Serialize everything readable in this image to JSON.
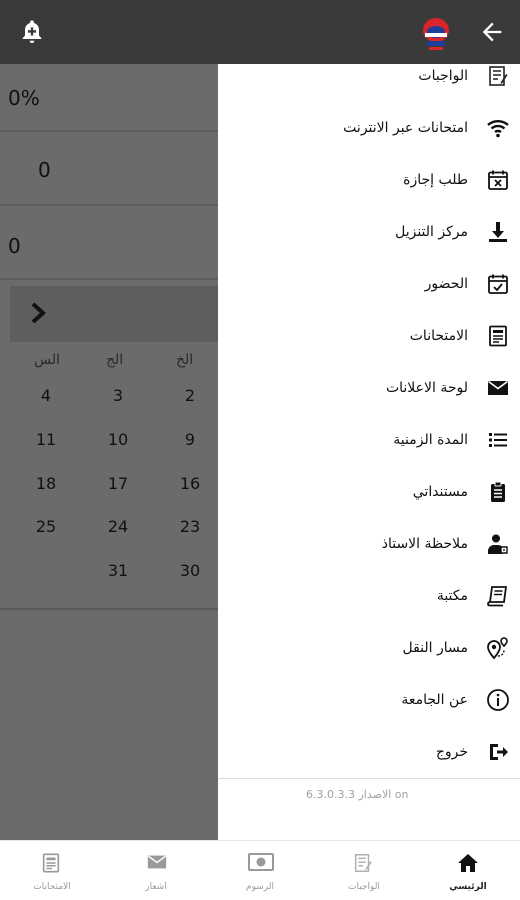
{
  "background": {
    "progress": "0%",
    "value_a": "0",
    "value_b": "0",
    "calendar": {
      "weekdays": [
        "الخ",
        "الج",
        "الس"
      ],
      "rows": [
        [
          "2",
          "3",
          "4"
        ],
        [
          "9",
          "10",
          "11"
        ],
        [
          "16",
          "17",
          "18"
        ],
        [
          "23",
          "24",
          "25"
        ],
        [
          "30",
          "31",
          ""
        ]
      ]
    }
  },
  "drawer": {
    "items": [
      {
        "label": "الواجبات",
        "icon": "homework-icon"
      },
      {
        "label": "امتحانات عبر الانترنت",
        "icon": "wifi-icon"
      },
      {
        "label": "طلب إجازة",
        "icon": "calendar-x-icon"
      },
      {
        "label": "مركز التنزيل",
        "icon": "download-icon"
      },
      {
        "label": "الحضور",
        "icon": "calendar-check-icon"
      },
      {
        "label": "الامتحانات",
        "icon": "exam-icon"
      },
      {
        "label": "لوحة الاعلانات",
        "icon": "envelope-icon"
      },
      {
        "label": "المدة الزمنية",
        "icon": "list-icon"
      },
      {
        "label": "مستنداتي",
        "icon": "clipboard-icon"
      },
      {
        "label": "ملاحظة الاستاذ",
        "icon": "teacher-icon"
      },
      {
        "label": "مكتبة",
        "icon": "book-icon"
      },
      {
        "label": "مسار النقل",
        "icon": "route-pin-icon"
      },
      {
        "label": "عن الجامعة",
        "icon": "info-icon"
      },
      {
        "label": "خروج",
        "icon": "logout-icon"
      }
    ],
    "version": "الاصدار 6.3.0.3.3 on"
  },
  "bottom_nav": {
    "items": [
      {
        "label": "الامتحانات",
        "icon": "exam-icon"
      },
      {
        "label": "اشعار",
        "icon": "envelope-icon"
      },
      {
        "label": "الرسوم",
        "icon": "money-icon"
      },
      {
        "label": "الواجبات",
        "icon": "homework-icon"
      },
      {
        "label": "الرئيسي",
        "icon": "home-icon"
      }
    ],
    "active_index": 4
  },
  "colors": {
    "topbar": "#3a3a3a",
    "overlay": "#6b6b6b",
    "active_nav": "#222222",
    "inactive_nav": "#9a9a9a"
  }
}
